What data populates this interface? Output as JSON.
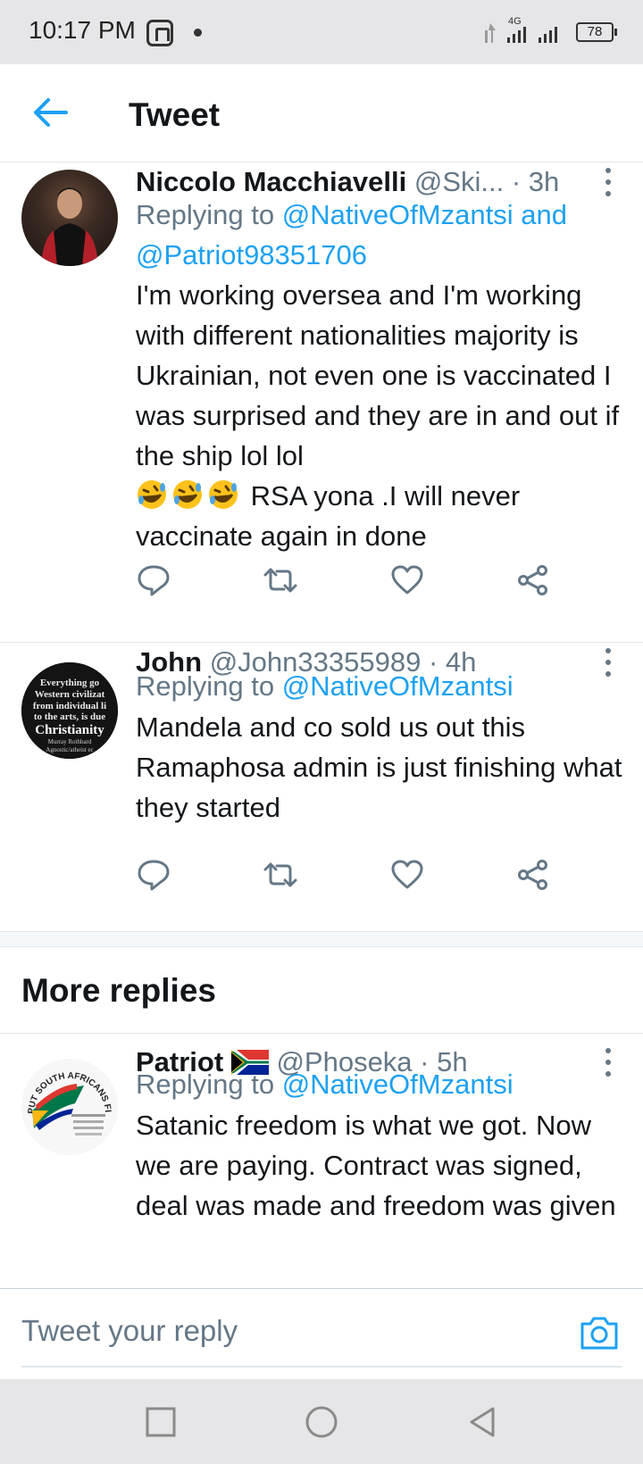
{
  "status_bar": {
    "time": "10:17 PM",
    "network": "4G",
    "battery": "78"
  },
  "header": {
    "title": "Tweet"
  },
  "tweets": [
    {
      "name": "Niccolo Macchiavelli",
      "handle": "@Ski...",
      "time": "· 3h",
      "replying_prefix": "Replying to ",
      "replying_to_1": "@NativeOfMzantsi",
      "replying_join": " and ",
      "replying_to_2": "@Patriot98351706",
      "text_before_emoji": "I'm working oversea and I'm working with different nationalities majority is Ukrainian, not even one is vaccinated I was surprised and they are in and out if the ship lol lol",
      "text_after_emoji": "RSA yona .I will never vaccinate again in done"
    },
    {
      "name": "John",
      "handle": "@John33355989",
      "time": "· 4h",
      "replying_prefix": "Replying to ",
      "replying_to_1": "@NativeOfMzantsi",
      "text": "Mandela and co sold us out this Ramaphosa admin is just finishing what they started",
      "avatar_text": [
        "Everything go",
        "Western civilizat",
        "from individual li",
        "to the arts, is due",
        "Christianity",
        "Murray Rothbard",
        "Agnostic/atheist ec"
      ]
    },
    {
      "name": "Patriot",
      "handle": "@Phoseka",
      "time": "· 5h",
      "replying_prefix": "Replying to ",
      "replying_to_1": "@NativeOfMzantsi",
      "text": "Satanic freedom is what we got. Now we are paying. Contract was signed, deal was made and freedom was given",
      "avatar_text_top": "PUT SOUTH AFRICANS FIRST"
    }
  ],
  "more_replies": {
    "title": "More replies"
  },
  "reply_bar": {
    "placeholder": "Tweet your reply"
  },
  "icons": {
    "back": "back-arrow-icon",
    "reply": "reply-icon",
    "retweet": "retweet-icon",
    "like": "heart-icon",
    "share": "share-icon",
    "camera": "camera-icon"
  },
  "colors": {
    "accent": "#1da1f2",
    "secondary_text": "#657786",
    "divider": "#e1e8ed"
  }
}
